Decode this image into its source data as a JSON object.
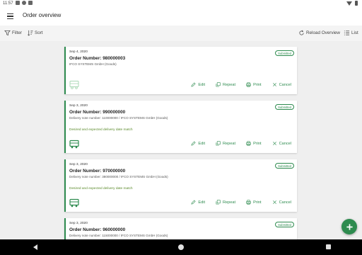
{
  "status": {
    "time": "11:57"
  },
  "appbar": {
    "title": "Order overview"
  },
  "toolbar": {
    "filter": "Filter",
    "sort": "Sort",
    "reload": "Reload Overview",
    "list": "List"
  },
  "actions": {
    "edit": "Edit",
    "repeat": "Repeat",
    "print": "Print",
    "cancel": "Cancel"
  },
  "orders": [
    {
      "date": "Sep 4, 2020",
      "status": "Submitted",
      "order_number": "Order Number: 980000003",
      "sub": "IFCO SYSTEMS GmbH (Goods)",
      "note": ""
    },
    {
      "date": "Sep 3, 2020",
      "status": "Submitted",
      "order_number": "Order Number: 990000000",
      "sub": "Delivery note number: 110000000 / IFCO SYSTEMS GmbH (Goods)",
      "note": "Desired and expected delivery date match"
    },
    {
      "date": "Sep 3, 2020",
      "status": "Submitted",
      "order_number": "Order Number: 970000000",
      "sub": "Delivery note number: 380000000 / IFCO SYSTEMS GmbH (Goods)",
      "note": "Desired and expected delivery date match"
    },
    {
      "date": "Sep 3, 2020",
      "status": "Submitted",
      "order_number": "Order Number: 960000000",
      "sub": "Delivery note number: 115000000 / IFCO SYSTEMS GmbH (Goods)",
      "note": ""
    }
  ],
  "colors": {
    "accent": "#2e8b4f",
    "note": "#5a8a2a",
    "background": "#efefef"
  },
  "icons": [
    "menu-icon",
    "filter-icon",
    "sort-icon",
    "reload-icon",
    "list-icon",
    "truck-icon",
    "edit-icon",
    "repeat-icon",
    "print-icon",
    "cancel-icon",
    "add-icon"
  ]
}
